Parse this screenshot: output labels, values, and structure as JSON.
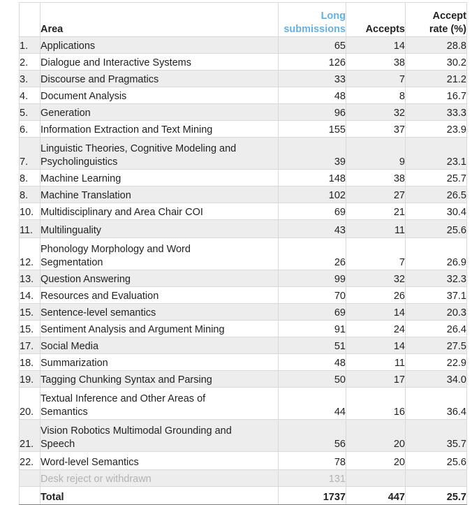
{
  "table": {
    "columns": {
      "index": "",
      "area": "Area",
      "long_submissions": "Long submissions",
      "long_submissions_line1": "Long",
      "long_submissions_line2": "submissions",
      "accepts": "Accepts",
      "accept_rate_line1": "Accept",
      "accept_rate_line2": "rate (%)",
      "accept_rate": "Accept rate (%)"
    },
    "header_accent_color": "#63b0e4",
    "rows": [
      {
        "index": "1.",
        "area": "Applications",
        "area_line2": "",
        "long": "65",
        "accepts": "14",
        "rate": "28.8"
      },
      {
        "index": "2.",
        "area": "Dialogue and Interactive Systems",
        "area_line2": "",
        "long": "126",
        "accepts": "38",
        "rate": "30.2"
      },
      {
        "index": "3.",
        "area": "Discourse and Pragmatics",
        "area_line2": "",
        "long": "33",
        "accepts": "7",
        "rate": "21.2"
      },
      {
        "index": "4.",
        "area": "Document Analysis",
        "area_line2": "",
        "long": "48",
        "accepts": "8",
        "rate": "16.7"
      },
      {
        "index": "5.",
        "area": "Generation",
        "area_line2": "",
        "long": "96",
        "accepts": "32",
        "rate": "33.3"
      },
      {
        "index": "6.",
        "area": "Information Extraction and Text Mining",
        "area_line2": "",
        "long": "155",
        "accepts": "37",
        "rate": "23.9"
      },
      {
        "index": "7.",
        "area": "Linguistic Theories, Cognitive Modeling and",
        "area_line2": "Psycholinguistics",
        "long": "39",
        "accepts": "9",
        "rate": "23.1"
      },
      {
        "index": "8.",
        "area": "Machine Learning",
        "area_line2": "",
        "long": "148",
        "accepts": "38",
        "rate": "25.7"
      },
      {
        "index": "8.",
        "area": "Machine Translation",
        "area_line2": "",
        "long": "102",
        "accepts": "27",
        "rate": "26.5"
      },
      {
        "index": "10.",
        "area": "Multidisciplinary and Area Chair COI",
        "area_line2": "",
        "long": "69",
        "accepts": "21",
        "rate": "30.4"
      },
      {
        "index": "11.",
        "area": "Multilinguality",
        "area_line2": "",
        "long": "43",
        "accepts": "11",
        "rate": "25.6"
      },
      {
        "index": "12.",
        "area": "Phonology Morphology and Word",
        "area_line2": "Segmentation",
        "long": "26",
        "accepts": "7",
        "rate": "26.9"
      },
      {
        "index": "13.",
        "area": "Question Answering",
        "area_line2": "",
        "long": "99",
        "accepts": "32",
        "rate": "32.3"
      },
      {
        "index": "14.",
        "area": "Resources and Evaluation",
        "area_line2": "",
        "long": "70",
        "accepts": "26",
        "rate": "37.1"
      },
      {
        "index": "15.",
        "area": "Sentence-level semantics",
        "area_line2": "",
        "long": "69",
        "accepts": "14",
        "rate": "20.3"
      },
      {
        "index": "15.",
        "area": "Sentiment Analysis and Argument Mining",
        "area_line2": "",
        "long": "91",
        "accepts": "24",
        "rate": "26.4"
      },
      {
        "index": "17.",
        "area": "Social Media",
        "area_line2": "",
        "long": "51",
        "accepts": "14",
        "rate": "27.5"
      },
      {
        "index": "18.",
        "area": "Summarization",
        "area_line2": "",
        "long": "48",
        "accepts": "11",
        "rate": "22.9"
      },
      {
        "index": "19.",
        "area": "Tagging Chunking Syntax and Parsing",
        "area_line2": "",
        "long": "50",
        "accepts": "17",
        "rate": "34.0"
      },
      {
        "index": "20.",
        "area": "Textual Inference and Other Areas of",
        "area_line2": "Semantics",
        "long": "44",
        "accepts": "16",
        "rate": "36.4"
      },
      {
        "index": "21.",
        "area": "Vision Robotics Multimodal Grounding and",
        "area_line2": "Speech",
        "long": "56",
        "accepts": "20",
        "rate": "35.7"
      },
      {
        "index": "22.",
        "area": "Word-level Semantics",
        "area_line2": "",
        "long": "78",
        "accepts": "20",
        "rate": "25.6"
      }
    ],
    "desk_reject": {
      "index": "",
      "area": "Desk reject or withdrawn",
      "long": "131",
      "accepts": "",
      "rate": ""
    },
    "total": {
      "index": "",
      "area": "Total",
      "long": "1737",
      "accepts": "447",
      "rate": "25.7"
    }
  },
  "chart_data": {
    "type": "table",
    "title": "Long submissions, accepts and accept rate by area",
    "columns": [
      "#",
      "Area",
      "Long submissions",
      "Accepts",
      "Accept rate (%)"
    ],
    "categories": [
      "Applications",
      "Dialogue and Interactive Systems",
      "Discourse and Pragmatics",
      "Document Analysis",
      "Generation",
      "Information Extraction and Text Mining",
      "Linguistic Theories, Cognitive Modeling and Psycholinguistics",
      "Machine Learning",
      "Machine Translation",
      "Multidisciplinary and Area Chair COI",
      "Multilinguality",
      "Phonology Morphology and Word Segmentation",
      "Question Answering",
      "Resources and Evaluation",
      "Sentence-level semantics",
      "Sentiment Analysis and Argument Mining",
      "Social Media",
      "Summarization",
      "Tagging Chunking Syntax and Parsing",
      "Textual Inference and Other Areas of Semantics",
      "Vision Robotics Multimodal Grounding and Speech",
      "Word-level Semantics",
      "Desk reject or withdrawn",
      "Total"
    ],
    "series": [
      {
        "name": "Long submissions",
        "values": [
          65,
          126,
          33,
          48,
          96,
          155,
          39,
          148,
          102,
          69,
          43,
          26,
          99,
          70,
          69,
          91,
          51,
          48,
          50,
          44,
          56,
          78,
          131,
          1737
        ]
      },
      {
        "name": "Accepts",
        "values": [
          14,
          38,
          7,
          8,
          32,
          37,
          9,
          38,
          27,
          21,
          11,
          7,
          32,
          26,
          14,
          24,
          14,
          11,
          17,
          16,
          20,
          20,
          null,
          447
        ]
      },
      {
        "name": "Accept rate (%)",
        "values": [
          28.8,
          30.2,
          21.2,
          16.7,
          33.3,
          23.9,
          23.1,
          25.7,
          26.5,
          30.4,
          25.6,
          26.9,
          32.3,
          37.1,
          20.3,
          26.4,
          27.5,
          22.9,
          34.0,
          36.4,
          35.7,
          25.6,
          null,
          25.7
        ]
      }
    ]
  }
}
